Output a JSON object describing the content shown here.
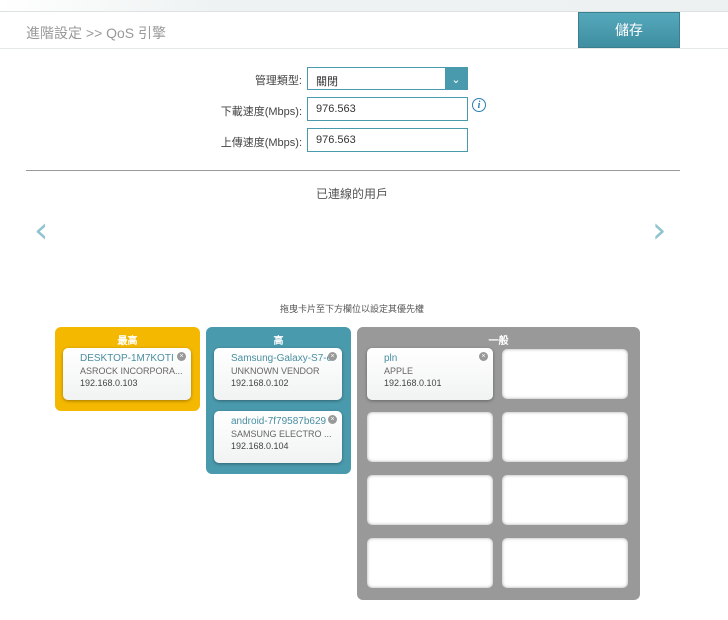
{
  "header": {
    "breadcrumb": "進階設定 >> QoS 引擎",
    "save_label": "儲存"
  },
  "form": {
    "mgmt_label": "管理類型:",
    "mgmt_value": "關閉",
    "download_label": "下載速度(Mbps):",
    "download_value": "976.563",
    "upload_label": "上傳速度(Mbps):",
    "upload_value": "976.563",
    "info_icon": "i"
  },
  "clients": {
    "title": "已連線的用戶",
    "prev": "‹",
    "next": "›",
    "hint": "拖曳卡片至下方欄位以設定其優先權"
  },
  "priority": {
    "highest": {
      "title": "最高",
      "color": "#f5b800",
      "cards": [
        {
          "name": "DESKTOP-1M7KOTI",
          "vendor": "ASROCK INCORPORA...",
          "ip": "192.168.0.103"
        }
      ]
    },
    "high": {
      "title": "高",
      "color": "#4a9aad",
      "cards": [
        {
          "name": "Samsung-Galaxy-S7-e",
          "vendor": "UNKNOWN VENDOR",
          "ip": "192.168.0.102"
        },
        {
          "name": "android-7f79587b629",
          "vendor": "SAMSUNG ELECTRO ...",
          "ip": "192.168.0.104"
        }
      ]
    },
    "normal": {
      "title": "一般",
      "color": "#999999",
      "cards": [
        {
          "name": "pln",
          "vendor": "APPLE",
          "ip": "192.168.0.101"
        }
      ]
    }
  }
}
